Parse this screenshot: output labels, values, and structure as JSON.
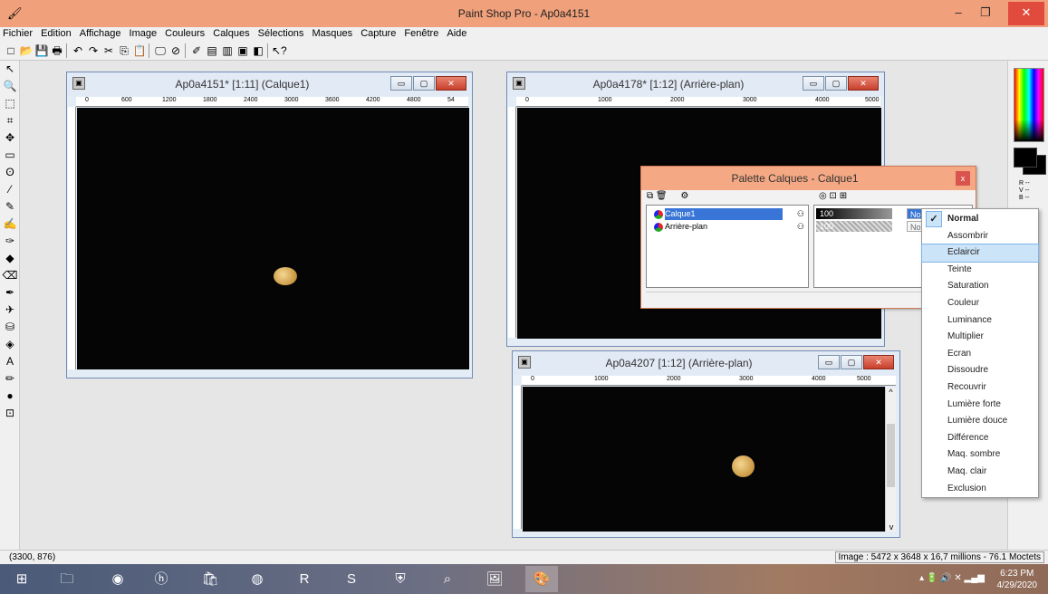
{
  "app": {
    "title": "Paint Shop Pro - Ap0a4151",
    "minimize": "–",
    "maximize": "❐",
    "close": "✕"
  },
  "menu": [
    "Fichier",
    "Edition",
    "Affichage",
    "Image",
    "Couleurs",
    "Calques",
    "Sélections",
    "Masques",
    "Capture",
    "Fenêtre",
    "Aide"
  ],
  "windows": {
    "win1": {
      "title": "Ap0a4151* [1:11] (Calque1)",
      "ruler": [
        "0",
        "600",
        "1200",
        "1800",
        "2400",
        "3000",
        "3600",
        "4200",
        "4800",
        "54"
      ]
    },
    "win2": {
      "title": "Ap0a4178* [1:12] (Arrière-plan)",
      "ruler": [
        "0",
        "1000",
        "2000",
        "3000",
        "4000",
        "5000"
      ]
    },
    "win3": {
      "title": "Ap0a4207 [1:12] (Arrière-plan)",
      "ruler": [
        "0",
        "1000",
        "2000",
        "3000",
        "4000",
        "5000"
      ]
    }
  },
  "palette": {
    "title": "Palette Calques - Calque1",
    "layers": [
      {
        "name": "Calque1",
        "opacity": "100",
        "mode": "Nor"
      },
      {
        "name": "Arrière-plan",
        "opacity": "100",
        "mode": "Nor"
      }
    ]
  },
  "blend_modes": {
    "options": [
      "Normal",
      "Assombrir",
      "Eclaircir",
      "Teinte",
      "Saturation",
      "Couleur",
      "Luminance",
      "Multiplier",
      "Ecran",
      "Dissoudre",
      "Recouvrir",
      "Lumière forte",
      "Lumière douce",
      "Différence",
      "Maq. sombre",
      "Maq. clair",
      "Exclusion"
    ],
    "checked": "Normal",
    "highlighted": "Eclaircir"
  },
  "color_panel": {
    "rgb_labels": "R --\nV --\nB --"
  },
  "status": {
    "coords": "(3300, 876)",
    "image_info": "Image :  5472 x 3648 x 16,7 millions - 76.1 Moctets"
  },
  "taskbar": {
    "time": "6:23 PM",
    "date": "4/29/2020"
  }
}
